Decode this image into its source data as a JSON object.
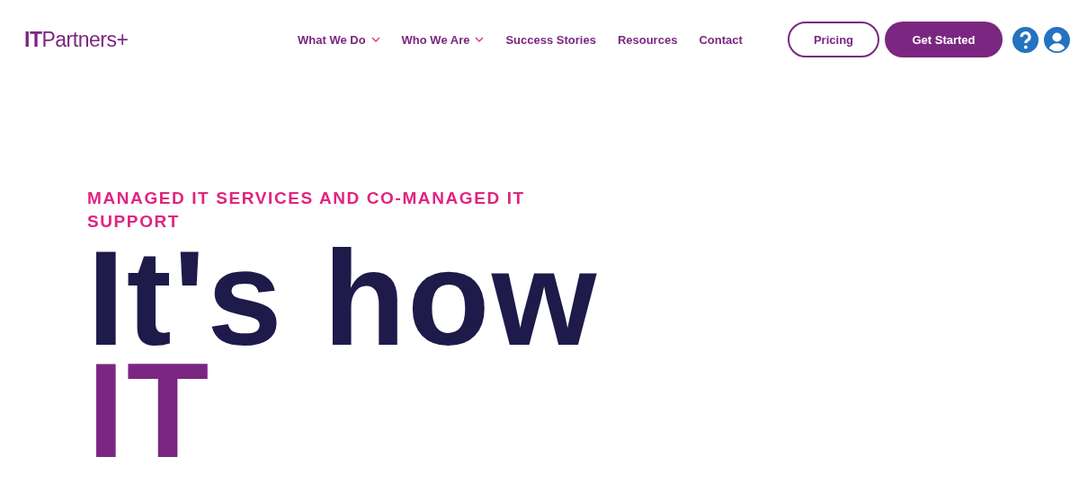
{
  "header": {
    "logo": "**IT**Partners+",
    "nav": [
      {
        "label": "What We Do",
        "kind": "dropdown"
      },
      {
        "label": "Who We Are",
        "kind": "dropdown"
      },
      {
        "label": "Success Stories",
        "kind": "link"
      },
      {
        "label": "Resources",
        "kind": "link"
      },
      {
        "label": "Contact",
        "kind": "link"
      }
    ],
    "buttons": [
      {
        "label": "Pricing",
        "kind": "outline"
      },
      {
        "label": "Get Started",
        "kind": "filled"
      }
    ],
    "icons": [
      {
        "kind": "help"
      },
      {
        "kind": "account"
      }
    ]
  },
  "hero": {
    "eyebrow": "MANAGED IT SERVICES AND CO-MANAGED IT SUPPORT",
    "headline": [
      {
        "text": "It's how",
        "accent": false
      },
      {
        "text": "IT",
        "accent": true
      }
    ]
  }
}
